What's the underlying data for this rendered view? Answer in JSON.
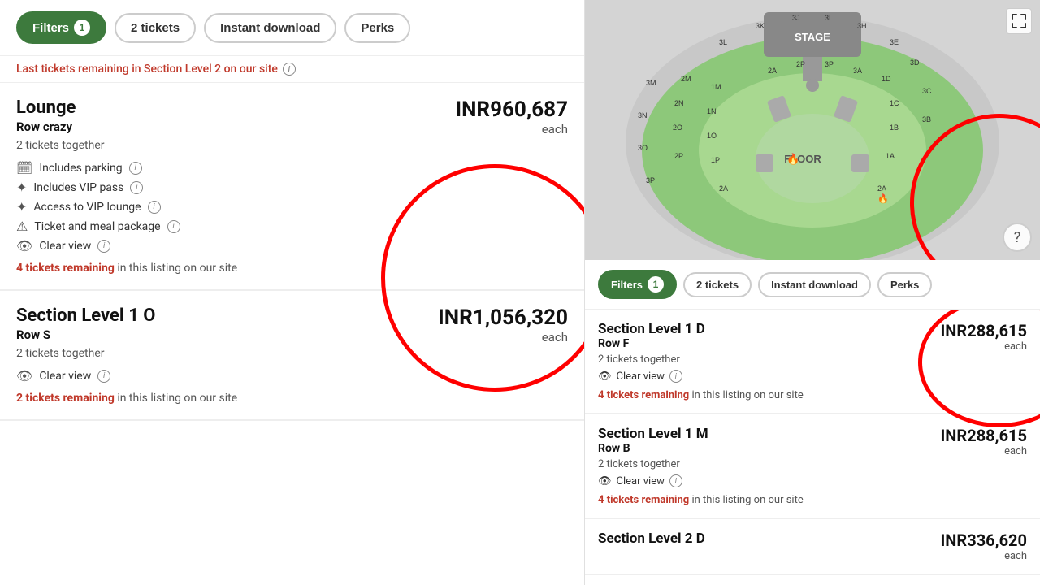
{
  "left": {
    "filters": {
      "filters_label": "Filters",
      "filters_badge": "1",
      "tickets_label": "2 tickets",
      "instant_label": "Instant download",
      "perks_label": "Perks"
    },
    "banner": {
      "text": "Last tickets remaining in Section Level 2 on our site",
      "info": "i"
    },
    "lounge_listing": {
      "section": "Lounge",
      "row": "Row crazy",
      "tickets_together": "2 tickets together",
      "price": "INR960,687",
      "each": "each",
      "features": [
        {
          "icon": "🗓",
          "text": "Includes parking"
        },
        {
          "icon": "✦",
          "text": "Includes VIP pass"
        },
        {
          "icon": "✦",
          "text": "Access to VIP lounge"
        },
        {
          "icon": "⚠",
          "text": "Ticket and meal package"
        },
        {
          "icon": "👁",
          "text": "Clear view"
        }
      ],
      "remaining_count": "4 tickets remaining",
      "remaining_text": "in this listing on our site"
    },
    "level1o_listing": {
      "section": "Section Level 1 O",
      "row": "Row S",
      "tickets_together": "2 tickets together",
      "price": "INR1,056,320",
      "each": "each",
      "features": [
        {
          "icon": "👁",
          "text": "Clear view"
        }
      ],
      "remaining_count": "2 tickets remaining",
      "remaining_text": "in this listing on our site"
    }
  },
  "right": {
    "filters": {
      "filters_label": "Filters",
      "filters_badge": "1",
      "tickets_label": "2 tickets",
      "instant_label": "Instant download",
      "perks_label": "Perks"
    },
    "listings": [
      {
        "section": "Section Level 1 D",
        "row": "Row F",
        "tickets_together": "2 tickets together",
        "price": "INR288,615",
        "each": "each",
        "features": [
          {
            "icon": "👁",
            "text": "Clear view"
          }
        ],
        "remaining_count": "4 tickets remaining",
        "remaining_text": "in this listing on our site"
      },
      {
        "section": "Section Level 1 M",
        "row": "Row B",
        "tickets_together": "2 tickets together",
        "price": "INR288,615",
        "each": "each",
        "features": [
          {
            "icon": "👁",
            "text": "Clear view"
          }
        ],
        "remaining_count": "4 tickets remaining",
        "remaining_text": "in this listing on our site"
      },
      {
        "section": "Section Level 2 D",
        "row": "",
        "tickets_together": "",
        "price": "INR336,620",
        "each": "each",
        "features": [],
        "remaining_count": "",
        "remaining_text": ""
      }
    ],
    "map": {
      "stage_label": "STAGE",
      "floor_label": "FLOOR"
    }
  },
  "icons": {
    "fullscreen": "⛶",
    "help": "?",
    "info": "i",
    "parking": "🗓",
    "vip": "✦",
    "warning": "⚠",
    "eye": "👁"
  }
}
